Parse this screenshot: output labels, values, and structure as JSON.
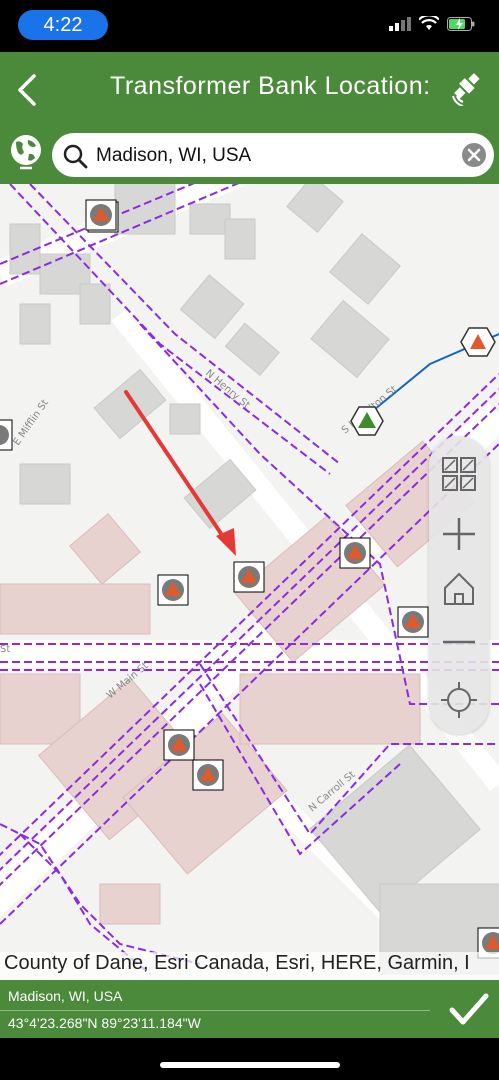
{
  "status_bar": {
    "time": "4:22"
  },
  "header": {
    "title": "Transformer Bank Location:"
  },
  "search": {
    "value": "Madison, WI, USA",
    "placeholder": "Search"
  },
  "map": {
    "streets": [
      "E Mifflin St",
      "N Henry St",
      "W Main St",
      "N Carroll St",
      "S Hamilton St",
      "St"
    ],
    "attribution": "County of Dane, Esri Canada, Esri, HERE, Garmin, I"
  },
  "footer": {
    "location_name": "Madison, WI, USA",
    "coordinates": "43°4'23.268\"N 89°23'11.184\"W"
  },
  "colors": {
    "header": "#4b8a3b",
    "status_pill": "#1a73e8",
    "utility_lines": "#8a2be2",
    "arrow": "#e53935"
  }
}
